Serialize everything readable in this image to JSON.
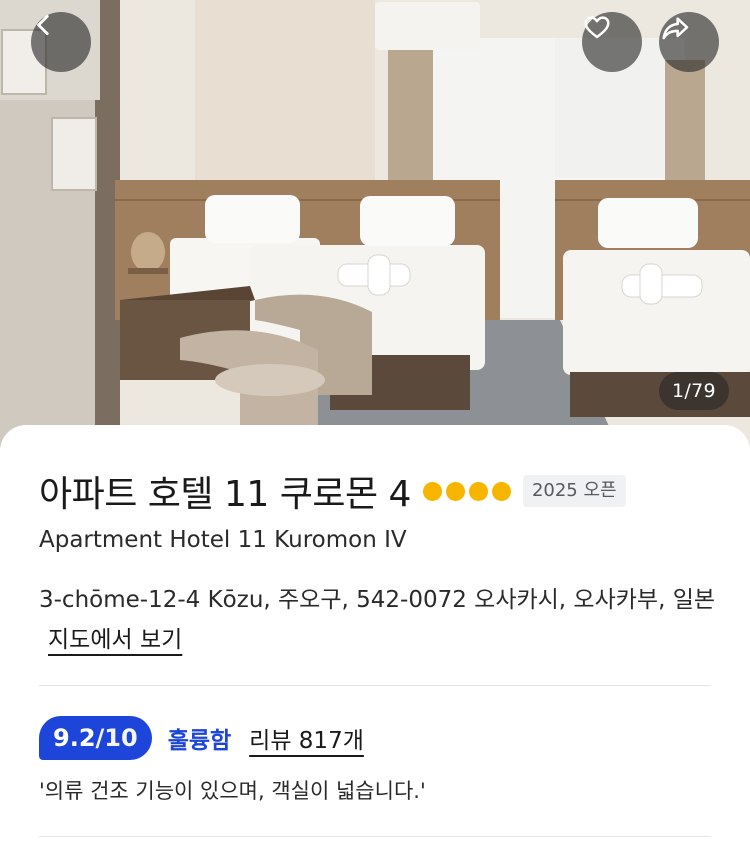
{
  "gallery": {
    "counter": "1/79",
    "back_icon": "chevron-left-icon",
    "favorite_icon": "heart-outline-icon",
    "share_icon": "share-arrow-icon"
  },
  "hotel": {
    "title": "아파트 호텔 11 쿠로몬 4",
    "star_count": 4,
    "star_color": "#f7b500",
    "open_badge": "2025 오픈",
    "name_en": "Apartment Hotel 11 Kuromon IV",
    "address": "3-chōme-12-4 Kōzu, 주오구, 542-0072 오사카시, 오사카부, 일본",
    "map_link": "지도에서 보기"
  },
  "rating": {
    "score": "9.2",
    "max": "/10",
    "label": "훌륭함",
    "reviews": "리뷰 817개",
    "quote": "'의류 건조 기능이 있으며, 객실이 넓습니다.'",
    "accent_color": "#1e45d9"
  }
}
